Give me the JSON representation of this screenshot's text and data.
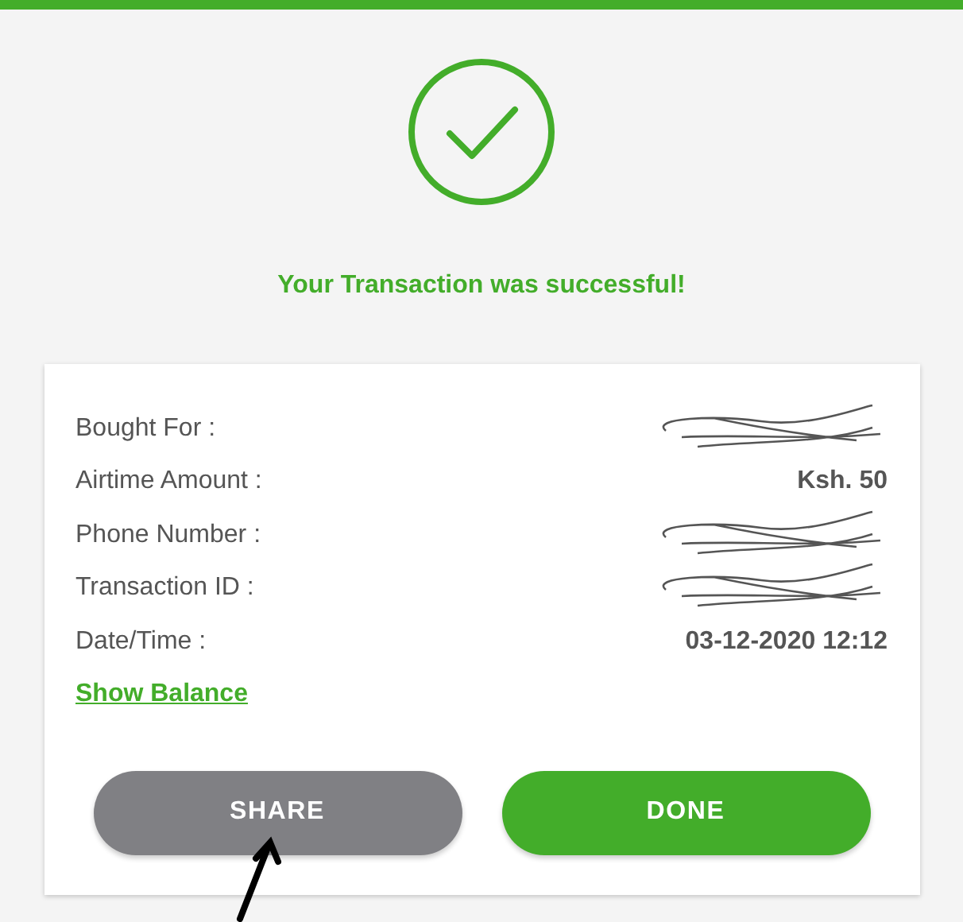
{
  "status": {
    "kind": "success",
    "message": "Your Transaction was successful!"
  },
  "details": [
    {
      "label": "Bought For :",
      "kind": "redacted"
    },
    {
      "label": "Airtime Amount :",
      "kind": "text",
      "value": "Ksh. 50"
    },
    {
      "label": "Phone Number :",
      "kind": "redacted"
    },
    {
      "label": "Transaction ID :",
      "kind": "redacted"
    },
    {
      "label": "Date/Time :",
      "kind": "text",
      "value": "03-12-2020 12:12"
    }
  ],
  "link": "Show Balance",
  "buttons": [
    {
      "label": "SHARE",
      "kind": "secondary"
    },
    {
      "label": "DONE",
      "kind": "primary"
    }
  ]
}
